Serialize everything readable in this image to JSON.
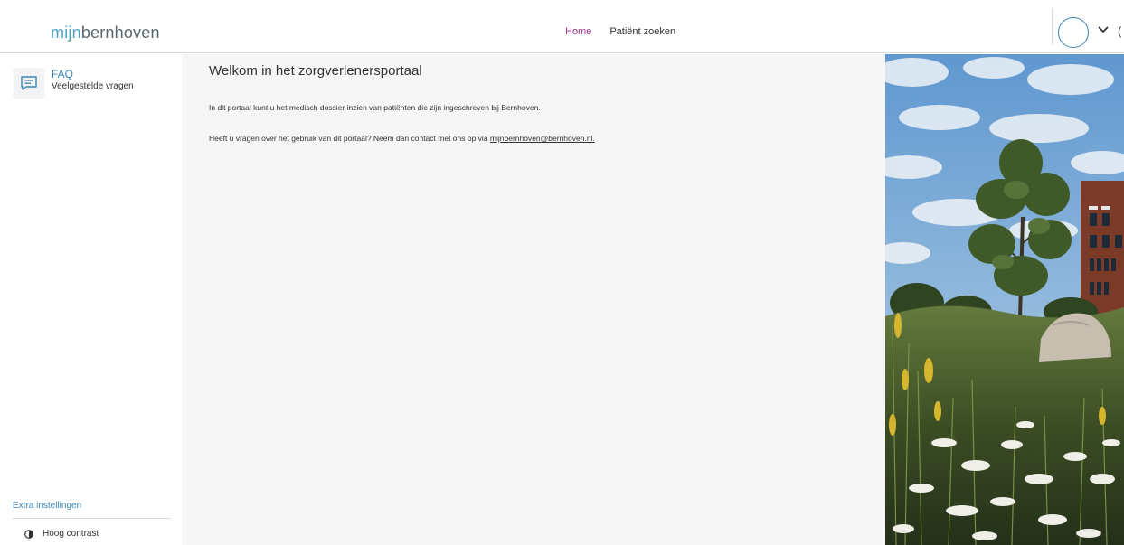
{
  "header": {
    "logo_mijn": "mijn",
    "logo_rest": "bernhoven",
    "nav": [
      {
        "label": "Home",
        "active": true
      },
      {
        "label": "Patiënt zoeken",
        "active": false
      }
    ],
    "cut_char": "("
  },
  "sidebar": {
    "faq_title": "FAQ",
    "faq_subtitle": "Veelgestelde vragen",
    "extra_label": "Extra instellingen",
    "contrast_label": "Hoog contrast"
  },
  "main": {
    "title": "Welkom in het zorgverlenersportaal",
    "intro": "In dit portaal kunt u het medisch dossier inzien van patiënten die zijn ingeschreven bij Bernhoven.",
    "contact_prefix": "Heeft u vragen over het gebruik van dit portaal? Neem dan contact met ons op via ",
    "contact_email": "mijnbernhoven@bernhoven.nl."
  },
  "colors": {
    "brand_blue": "#3a86b8",
    "active_nav": "#9b2f86",
    "content_bg": "#f6f6f7"
  }
}
